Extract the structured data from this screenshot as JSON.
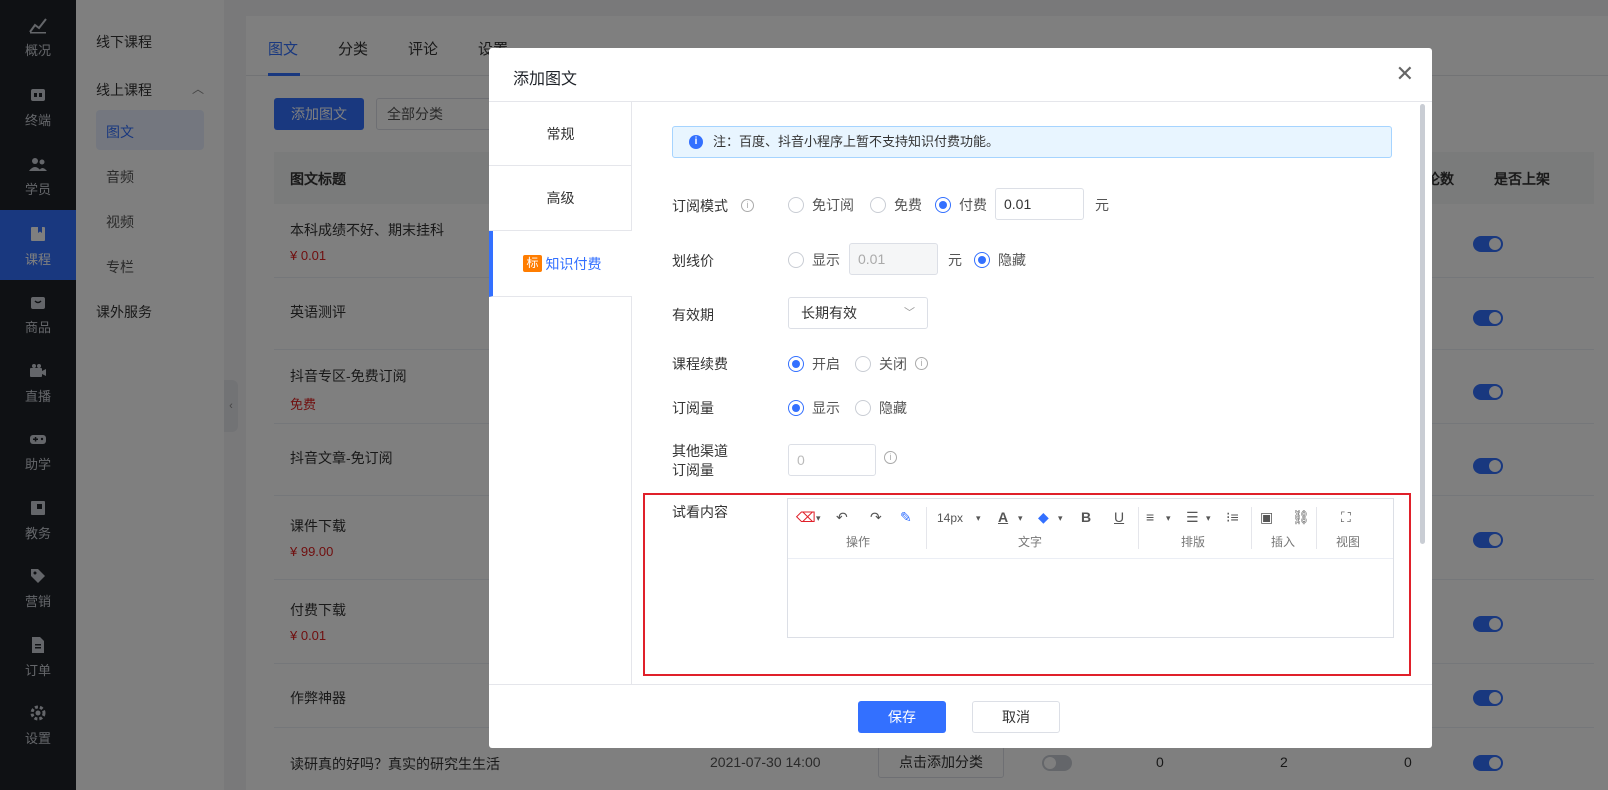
{
  "nav": {
    "items": [
      {
        "label": "概况",
        "icon": "chart-icon"
      },
      {
        "label": "终端",
        "icon": "terminal-icon"
      },
      {
        "label": "学员",
        "icon": "users-icon"
      },
      {
        "label": "课程",
        "icon": "book-icon"
      },
      {
        "label": "商品",
        "icon": "bag-icon"
      },
      {
        "label": "直播",
        "icon": "video-icon"
      },
      {
        "label": "助学",
        "icon": "gamepad-icon"
      },
      {
        "label": "教务",
        "icon": "calendar-icon"
      },
      {
        "label": "营销",
        "icon": "tag-icon"
      },
      {
        "label": "订单",
        "icon": "document-icon"
      },
      {
        "label": "设置",
        "icon": "gear-icon"
      }
    ],
    "active_color": "#3370ff"
  },
  "subnav": {
    "offline": "线下课程",
    "online": "线上课程",
    "online_items": [
      "图文",
      "音频",
      "视频",
      "专栏"
    ],
    "extra": "课外服务"
  },
  "main": {
    "tabs": [
      "图文",
      "分类",
      "评论",
      "设置"
    ],
    "add_button": "添加图文",
    "category_select": "全部分类",
    "columns": {
      "title": "图文标题",
      "comments": "论数",
      "listed": "是否上架"
    },
    "rows": [
      {
        "title": "本科成绩不好、期末挂科",
        "price": "¥ 0.01"
      },
      {
        "title": "英语测评",
        "price": ""
      },
      {
        "title": "抖音专区-免费订阅",
        "price": "免费"
      },
      {
        "title": "抖音文章-免订阅",
        "price": ""
      },
      {
        "title": "课件下载",
        "price": "¥ 99.00"
      },
      {
        "title": "付费下载",
        "price": "¥ 0.01"
      },
      {
        "title": "作弊神器",
        "price": ""
      },
      {
        "title": "读研真的好吗？真实的研究生生活",
        "price": ""
      }
    ],
    "last_row": {
      "date": "2021-07-30 14:00",
      "category_btn": "点击添加分类",
      "c1": "0",
      "c2": "2",
      "c3": "0"
    }
  },
  "dialog": {
    "title": "添加图文",
    "side_tabs": [
      "常规",
      "高级",
      "知识付费"
    ],
    "side_badge": "标",
    "notice": "注：百度、抖音小程序上暂不支持知识付费功能。",
    "subscribe_mode": {
      "label": "订阅模式",
      "options": [
        "免订阅",
        "免费",
        "付费"
      ],
      "price": "0.01",
      "unit": "元"
    },
    "strike_price": {
      "label": "划线价",
      "show": "显示",
      "value": "0.01",
      "unit": "元",
      "hide": "隐藏"
    },
    "validity": {
      "label": "有效期",
      "value": "长期有效"
    },
    "renewal": {
      "label": "课程续费",
      "on": "开启",
      "off": "关闭"
    },
    "subs_count": {
      "label": "订阅量",
      "show": "显示",
      "hide": "隐藏"
    },
    "other_channel": {
      "label_1": "其他渠道",
      "label_2": "订阅量",
      "placeholder": "0"
    },
    "preview": {
      "label": "试看内容"
    },
    "editor": {
      "font_size": "14px",
      "groups": [
        "操作",
        "文字",
        "排版",
        "插入",
        "视图"
      ]
    },
    "save": "保存",
    "cancel": "取消"
  }
}
